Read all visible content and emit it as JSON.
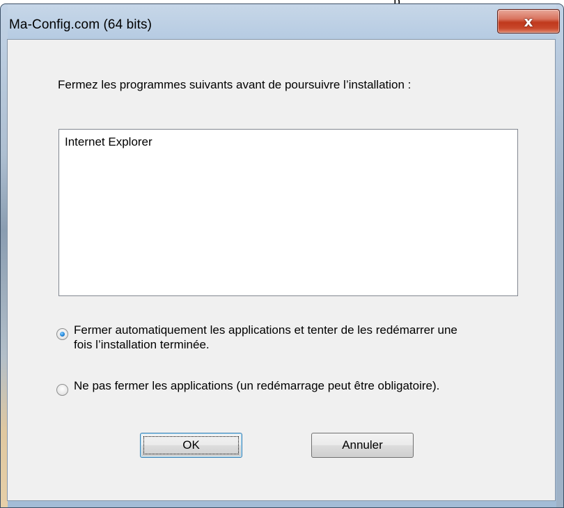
{
  "window": {
    "title": "Ma-Config.com (64 bits)",
    "close_glyph": "x"
  },
  "overlay_fragment": "p",
  "dialog": {
    "instruction": "Fermez les programmes suivants avant de poursuivre l’installation :",
    "programs": [
      "Internet Explorer"
    ],
    "options": [
      {
        "label": "Fermer automatiquement les applications et tenter de les redémarrer une fois l’installation terminée.",
        "checked": true
      },
      {
        "label": "Ne pas fermer les applications (un redémarrage peut être obligatoire).",
        "checked": false
      }
    ],
    "ok_label": "OK",
    "cancel_label": "Annuler"
  },
  "colors": {
    "client_bg": "#f0f0f0",
    "close_button": "#c7432a",
    "radio_dot": "#2a8ee0"
  }
}
